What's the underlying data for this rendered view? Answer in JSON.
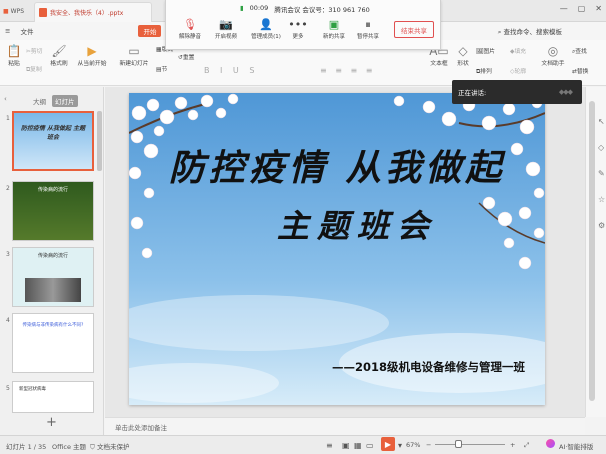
{
  "titlebar": {
    "app_name": "WPS",
    "doc_tab": "我安全、我快乐（4）.pptx",
    "window_controls": [
      "minimize",
      "maximize",
      "close"
    ]
  },
  "meeting": {
    "timer": "00:09",
    "meeting_label": "腾讯会议 会议号：310 961 760",
    "buttons": [
      "解除静音",
      "开启视频",
      "管理成员(1)",
      "更多",
      "新的共享",
      "暂停共享"
    ],
    "end_share": "结束共享"
  },
  "menubar": {
    "file": "文件",
    "start": "开始",
    "search": "查找命令、搜索模板"
  },
  "ribbon": {
    "paste": "粘贴",
    "cut": "剪切",
    "copy": "复制",
    "format": "格式刷",
    "from_current": "从当前开始",
    "new_slide": "新建幻灯片",
    "layout": "版式",
    "section": "节",
    "reset": "重置",
    "textbox": "文本框",
    "shape": "形状",
    "picture": "图片",
    "arrange": "排列",
    "fill": "填充",
    "outline": "轮廓",
    "doc_assistant": "文档助手",
    "find": "查找",
    "replace": "替换"
  },
  "sidebar": {
    "tabs": [
      "大纲",
      "幻灯片"
    ],
    "active_tab": "幻灯片",
    "slides": [
      {
        "num": "1",
        "title": "防控疫情 从我做起 主题班会"
      },
      {
        "num": "2",
        "title": "传染病的流行"
      },
      {
        "num": "3",
        "title": "传染病的流行"
      },
      {
        "num": "4",
        "title": "传染病与非传染病有什么不同?"
      },
      {
        "num": "5",
        "title": "新型冠状病毒"
      }
    ]
  },
  "slide": {
    "title": "防控疫情 从我做起",
    "subtitle": "主题班会",
    "class_line": "——2018级机电设备维修与管理一班"
  },
  "speaker_panel": {
    "label": "正在讲话:"
  },
  "notes": {
    "placeholder": "单击此处添加备注"
  },
  "statusbar": {
    "slide_counter": "幻灯片 1 / 35",
    "theme": "Office 主题",
    "protection": "文档未保护",
    "zoom": "67%",
    "ai_label": "AI·智能排版"
  }
}
